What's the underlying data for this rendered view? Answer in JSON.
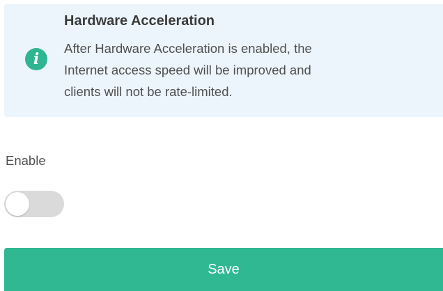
{
  "info": {
    "icon": "info-icon",
    "icon_glyph": "i",
    "title": "Hardware Acceleration",
    "lines": [
      "After Hardware Acceleration is enabled, the",
      "Internet access speed will be improved and",
      "clients will not be rate-limited."
    ],
    "background_color": "#edf5fc",
    "icon_color": "#2fb592"
  },
  "enable": {
    "label": "Enable",
    "toggle_state": "off"
  },
  "save": {
    "label": "Save",
    "color": "#30b893"
  }
}
